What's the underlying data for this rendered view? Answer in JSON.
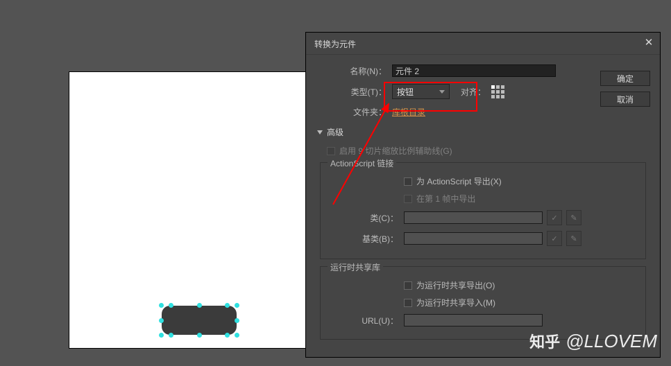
{
  "dialog": {
    "title": "转换为元件",
    "name_label": "名称(N)：",
    "name_value": "元件 2",
    "type_label": "类型(T)：",
    "type_value": "按钮",
    "align_label": "对齐：",
    "folder_label": "文件夹：",
    "folder_link": "库根目录",
    "ok": "确定",
    "cancel": "取消",
    "advanced": "高级",
    "enable_slice": "启用 9 切片缩放比例辅助线(G)",
    "as_section": "ActionScript 链接",
    "export_as": "为 ActionScript 导出(X)",
    "export_frame1": "在第 1 帧中导出",
    "class_label": "类(C)：",
    "base_label": "基类(B)：",
    "runtime_section": "运行时共享库",
    "runtime_export": "为运行时共享导出(O)",
    "runtime_import": "为运行时共享导入(M)",
    "url_label": "URL(U)："
  },
  "watermark": {
    "site": "知乎",
    "user": "@LLOVEM"
  }
}
